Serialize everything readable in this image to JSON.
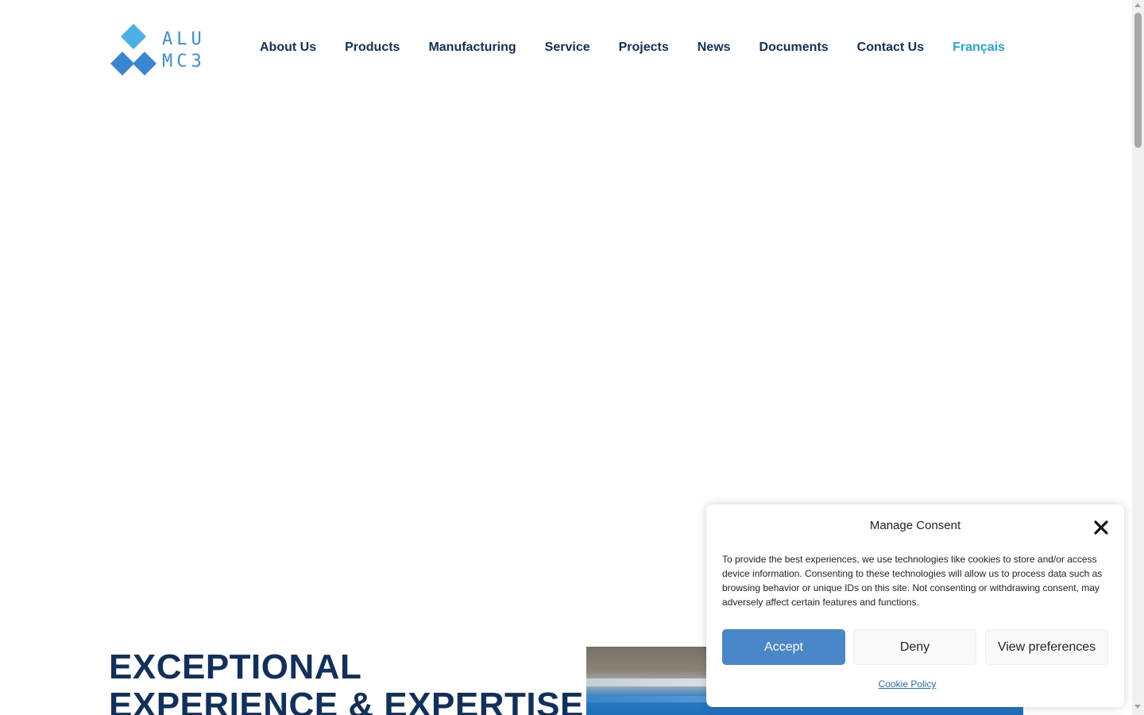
{
  "logo": {
    "line1": "ALU",
    "line2": "MC3",
    "color_light": "#4ab0e6",
    "color_dark": "#3a85cf"
  },
  "nav": {
    "items": [
      {
        "label": "About Us"
      },
      {
        "label": "Products"
      },
      {
        "label": "Manufacturing"
      },
      {
        "label": "Service"
      },
      {
        "label": "Projects"
      },
      {
        "label": "News"
      },
      {
        "label": "Documents"
      },
      {
        "label": "Contact Us"
      },
      {
        "label": "Français"
      }
    ],
    "text_color": "#11305b",
    "lang_color": "#22a8d6"
  },
  "hero": {
    "title_line1": "EXCEPTIONAL",
    "title_line2": "EXPERIENCE & EXPERTISE"
  },
  "consent": {
    "title": "Manage Consent",
    "body": "To provide the best experiences, we use technologies like cookies to store and/or access device information. Consenting to these technologies will allow us to process data such as browsing behavior or unique IDs on this site. Not consenting or withdrawing consent, may adversely affect certain features and functions.",
    "accept_label": "Accept",
    "deny_label": "Deny",
    "preferences_label": "View preferences",
    "cookie_policy_label": "Cookie Policy",
    "accent_color": "#4a87c8",
    "close_icon": "close-x-icon"
  }
}
